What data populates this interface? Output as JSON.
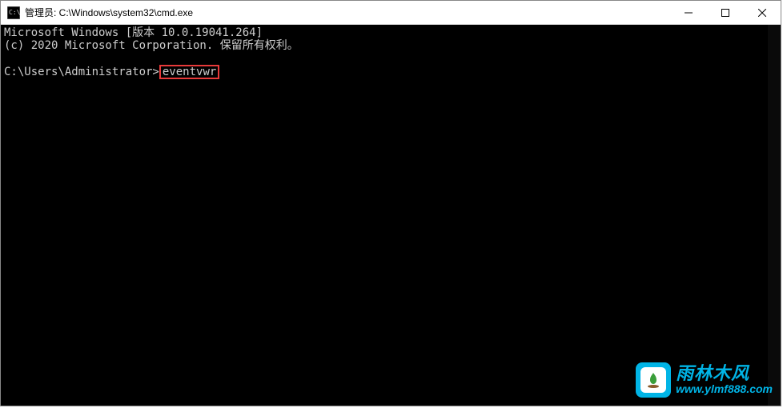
{
  "titlebar": {
    "title": "管理员: C:\\Windows\\system32\\cmd.exe"
  },
  "terminal": {
    "line1": "Microsoft Windows [版本 10.0.19041.264]",
    "line2": "(c) 2020 Microsoft Corporation. 保留所有权利。",
    "prompt": "C:\\Users\\Administrator>",
    "command": "eventvwr"
  },
  "watermark": {
    "name_cn": "雨林木风",
    "url": "www.ylmf888.com"
  }
}
